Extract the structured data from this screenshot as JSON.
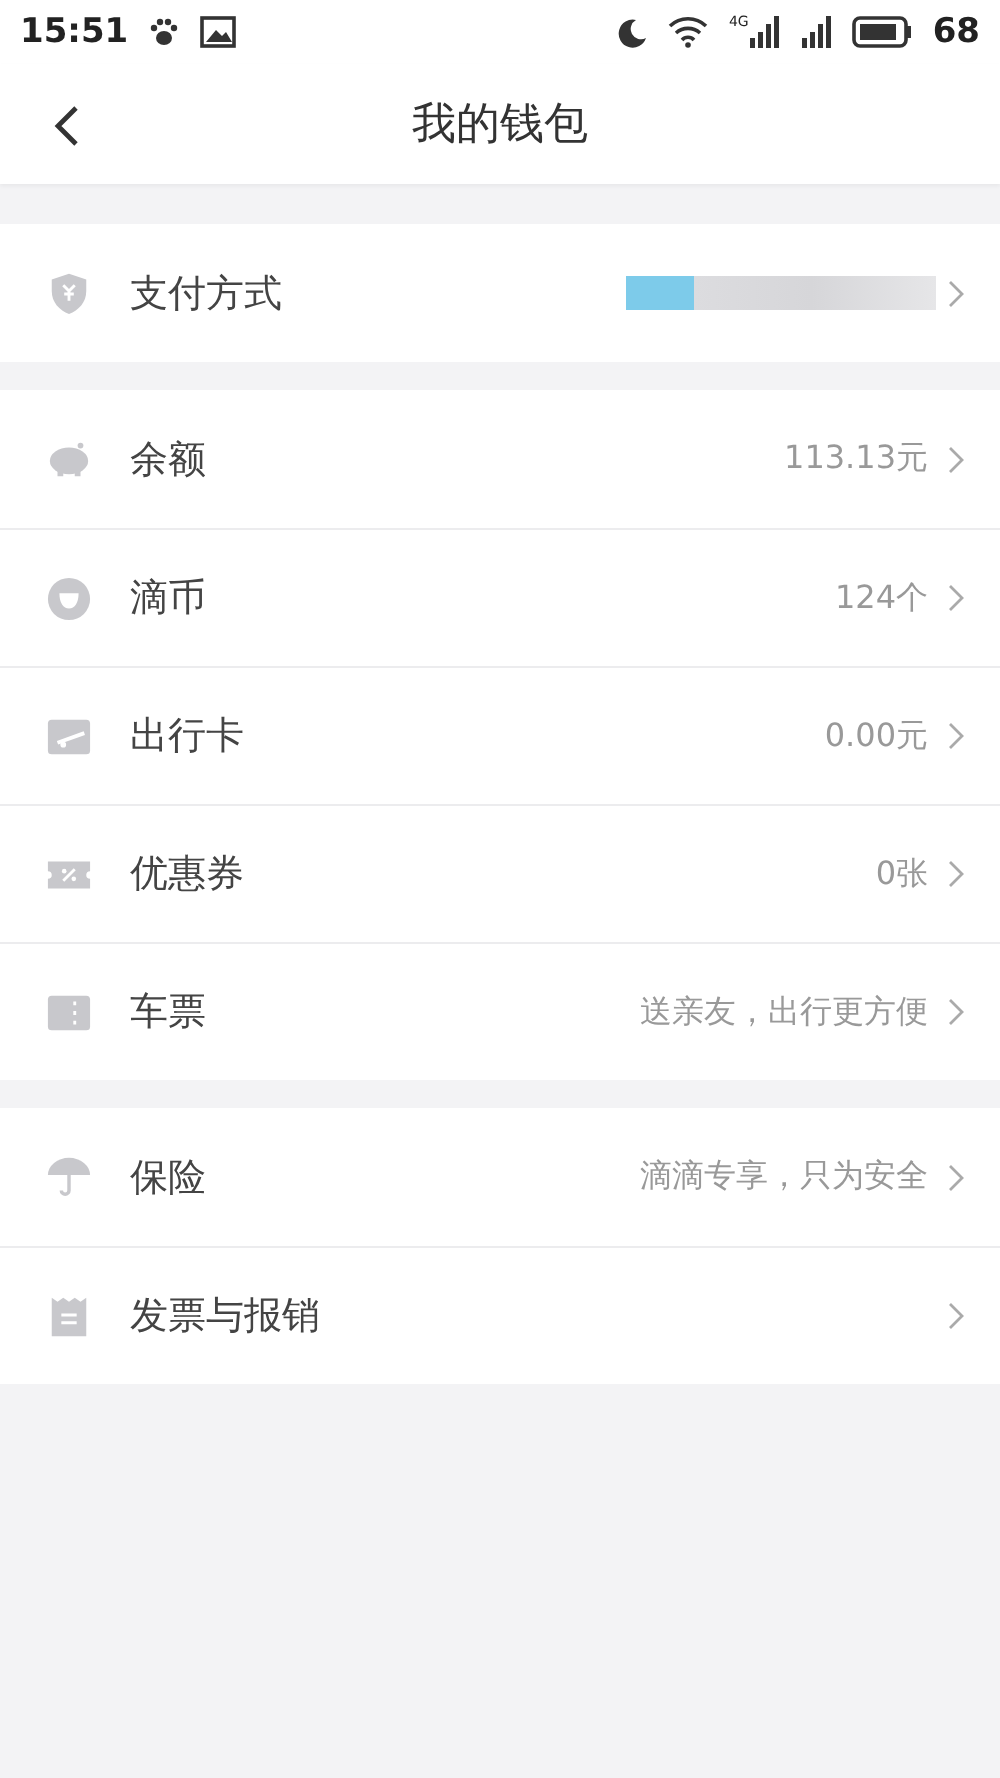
{
  "status_bar": {
    "time": "15:51",
    "network": "4G",
    "battery": "68"
  },
  "header": {
    "title": "我的钱包"
  },
  "sections": [
    {
      "rows": [
        {
          "kind": "shield",
          "label": "支付方式",
          "masked": true
        }
      ]
    },
    {
      "rows": [
        {
          "kind": "piggy",
          "label": "余额",
          "value": "113.13元"
        },
        {
          "kind": "coin",
          "label": "滴币",
          "value": "124个"
        },
        {
          "kind": "card",
          "label": "出行卡",
          "value": "0.00元"
        },
        {
          "kind": "coupon",
          "label": "优惠券",
          "value": "0张"
        },
        {
          "kind": "ticket",
          "label": "车票",
          "value": "送亲友，出行更方便"
        }
      ]
    },
    {
      "rows": [
        {
          "kind": "umbrella",
          "label": "保险",
          "value": "滴滴专享，只为安全"
        },
        {
          "kind": "receipt",
          "label": "发票与报销"
        }
      ]
    }
  ]
}
